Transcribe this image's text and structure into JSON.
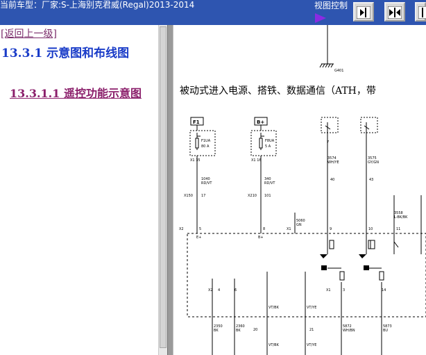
{
  "topbar": {
    "title": "当前车型：厂家:S-上海别克君威(Regal)2013-2014",
    "view_control_label": "视图控制",
    "buttons": [
      {
        "name": "expand-right-button",
        "icon": "collapse-right-icon"
      },
      {
        "name": "split-view-button",
        "icon": "split-view-icon"
      },
      {
        "name": "expand-left-button",
        "icon": "expand-left-icon"
      }
    ]
  },
  "left": {
    "back_link": "[返回上一级]",
    "section_title": "13.3.1  示意图和布线图",
    "subsection_title": "13.3.1.1  遥控功能示意图"
  },
  "diagram": {
    "heading": "被动式进入电源、搭铁、数据通信（ATH，带",
    "labels": {
      "g401": "G401",
      "f1_id": "F1",
      "f1_code": "F1UA",
      "f1_rating": "80 A",
      "b_id": "B+",
      "f8_code": "F8UA",
      "f8_rating": "5 A",
      "x1_35": "X1 35",
      "x1_16": "X1 16",
      "w1": "1040",
      "w1c": "RD/VT",
      "w2": "340",
      "w2c": "RD/VT",
      "w3": "5060",
      "w3c": "GN",
      "w4": "3574",
      "w4c": "WH/YE",
      "w5": "3575",
      "w5c": "GY/GN",
      "w6": "3558",
      "w6c": "L-BK/BK",
      "x150": "X150",
      "x210": "X210",
      "x1": "X1",
      "x2": "X2",
      "c17": "17",
      "c101": "101",
      "c40": "40",
      "c43": "43",
      "c5": "5",
      "c8": "8",
      "c9": "9",
      "c10": "10",
      "c11": "11",
      "c4": "4",
      "c6": "6",
      "c3": "3",
      "c14": "14",
      "c20": "20",
      "c21": "21",
      "c7": "7",
      "bplus": "B+",
      "eplus": "E+",
      "vtbk": "VT/BK",
      "vtye": "VT/YE",
      "w7": "2350",
      "w7c": "BK",
      "w8": "2360",
      "w8c": "BK",
      "w9": "5872",
      "w9c": "WH/BN",
      "w10": "5873",
      "w10c": "BU",
      "x2b": "X2",
      "x1b": "X1"
    }
  }
}
